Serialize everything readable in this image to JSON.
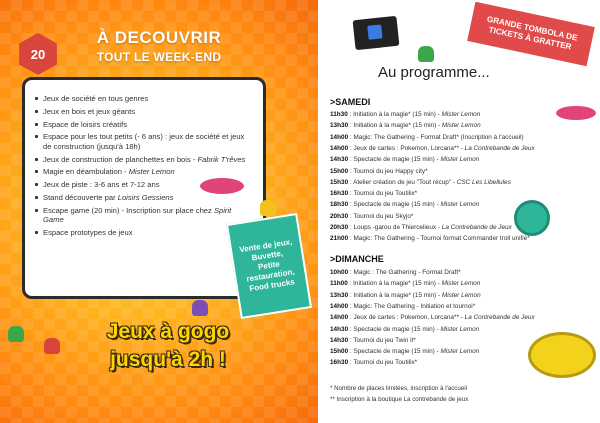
{
  "left": {
    "heading1": "À DECOUVRIR",
    "heading2": "TOUT LE WEEK-END",
    "die_number": "20",
    "activities": [
      {
        "text": "Jeux de société en tous genres"
      },
      {
        "text": "Jeux en bois et jeux géants"
      },
      {
        "text": "Espace de loisirs créatifs"
      },
      {
        "text": "Espace pour les tout petits (- 6 ans) : jeux de société et jeux de construction (jusqu'à 18h)"
      },
      {
        "text": "Jeux de construction de planchettes en bois - ",
        "credit": "Fabrik T'rêves"
      },
      {
        "text": "Magie en déambulation - ",
        "credit": "Mister Lemon"
      },
      {
        "text": "Jeux de piste : 3-6 ans et 7-12 ans"
      },
      {
        "text": "Stand découverte par ",
        "credit": "Loisirs Gessiens"
      },
      {
        "text": "Escape game (20 min) - Inscription sur place chez ",
        "credit": "Spirit Game"
      },
      {
        "text": "Espace prototypes de jeux"
      }
    ],
    "green_card": "Vente de jeux,\nBuvette,\nPetite\nrestauration,\nFood trucks",
    "slogan1": "Jeux à gogo",
    "slogan2": "jusqu'à 2h !"
  },
  "right": {
    "tombola1": "GRANDE TOMBOLA DE",
    "tombola2": "TICKETS À GRATTER",
    "programme_title": "Au programme...",
    "saturday": {
      "title": ">SAMEDI",
      "events": [
        {
          "time": "11h30",
          "text": "Initiation à la magie* (15 min) - ",
          "credit": "Mister Lemon"
        },
        {
          "time": "13h30",
          "text": "Initiation à la magie* (15 min) - ",
          "credit": "Mister Lemon"
        },
        {
          "time": "14h00",
          "text": "Magic: The Gathering - Format Draft* (Inscription à l'accueil)",
          "credit": ""
        },
        {
          "time": "14h00",
          "text": "Jeux de cartes : Pokemon, Lorcana** - ",
          "credit": "La Contrebande de Jeux"
        },
        {
          "time": "14h30",
          "text": "Spectacle de magie (15 min) - ",
          "credit": "Mister Lemon"
        },
        {
          "time": "15h00",
          "text": "Tournoi du jeu Happy city*",
          "credit": ""
        },
        {
          "time": "15h30",
          "text": "Atelier création de jeu \"Tout récup\" - ",
          "credit": "CSC Les Libellules"
        },
        {
          "time": "16h30",
          "text": "Tournoi du jeu Toutilix*",
          "credit": ""
        },
        {
          "time": "18h30",
          "text": "Spectacle de magie (15 min) - ",
          "credit": "Mister Lemon"
        },
        {
          "time": "20h30",
          "text": "Tournoi du jeu Skyjo*",
          "credit": ""
        },
        {
          "time": "20h30",
          "text": "Loups -garou de Thiercelieux - ",
          "credit": "La Contrebande de Jeux"
        },
        {
          "time": "21h00",
          "text": "Magic: The Gathering - Tournoi format Commander troll unifié*",
          "credit": ""
        }
      ]
    },
    "sunday": {
      "title": ">DIMANCHE",
      "events": [
        {
          "time": "10h00",
          "text": "Magic : The Gathering - Format Draft*",
          "credit": ""
        },
        {
          "time": "11h00",
          "text": "Initiation à la magie* (15 min) - ",
          "credit": "Mister Lemon"
        },
        {
          "time": "13h30",
          "text": "Initiation à la magie* (15 min) - ",
          "credit": "Mister Lemon"
        },
        {
          "time": "14h00",
          "text": "Magic: The Gathering - Initiation et tournoi*",
          "credit": ""
        },
        {
          "time": "14h00",
          "text": "Jeux de cartes : Pokemon, Lorcana** - ",
          "credit": "La Contrebande de Jeux"
        },
        {
          "time": "14h30",
          "text": "Spectacle de magie (15 min) - ",
          "credit": "Mister Lemon"
        },
        {
          "time": "14h30",
          "text": "Tournoi du jeu Twin it*",
          "credit": ""
        },
        {
          "time": "15h00",
          "text": "Spectacle de magie (15 min) - ",
          "credit": "Mister Lemon"
        },
        {
          "time": "16h30",
          "text": "Tournoi du jeu Toutilix*",
          "credit": ""
        }
      ]
    },
    "notes": [
      "* Nombre de places limitées, inscription à l'accueil",
      "** Inscription à la boutique La contrebande de jeux"
    ]
  },
  "colors": {
    "orange": "#ff8a12",
    "red": "#d8453c",
    "teal": "#2fb59a",
    "yellow": "#ffd400"
  }
}
